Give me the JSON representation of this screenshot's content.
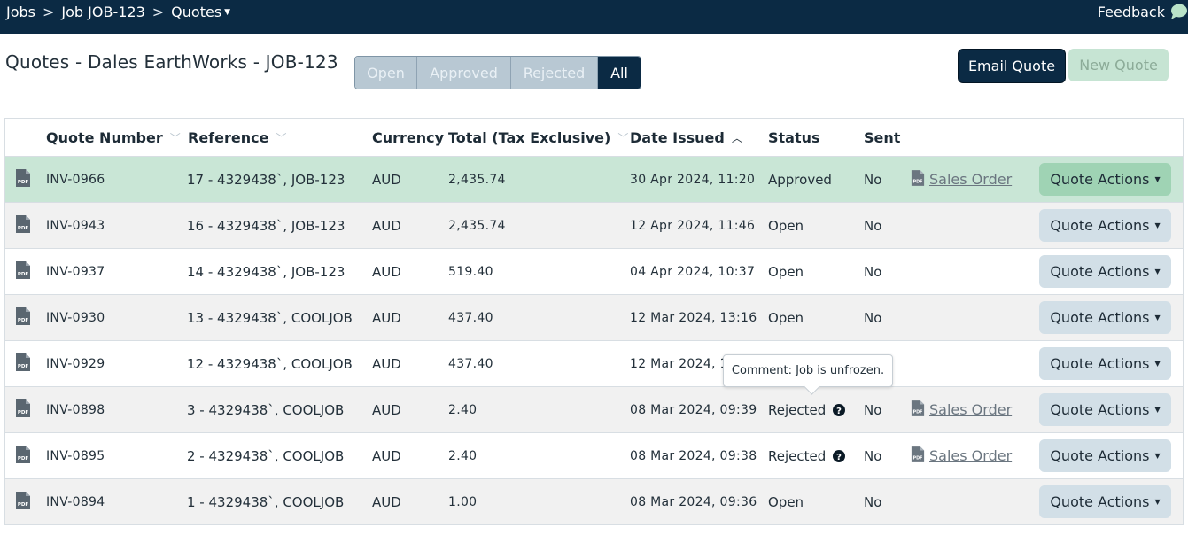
{
  "breadcrumb": {
    "items": [
      "Jobs",
      "Job JOB-123",
      "Quotes"
    ],
    "separator": ">"
  },
  "feedback_label": "Feedback",
  "page_title": "Quotes - Dales EarthWorks - JOB-123",
  "filters": [
    {
      "label": "Open",
      "active": false
    },
    {
      "label": "Approved",
      "active": false
    },
    {
      "label": "Rejected",
      "active": false
    },
    {
      "label": "All",
      "active": true
    }
  ],
  "buttons": {
    "email_quote": "Email Quote",
    "new_quote": "New Quote"
  },
  "table": {
    "headers": {
      "quote_number": "Quote Number",
      "reference": "Reference",
      "currency": "Currency",
      "total": "Total (Tax Exclusive)",
      "date_issued": "Date Issued",
      "status": "Status",
      "sent": "Sent"
    },
    "rows": [
      {
        "quote_number": "INV-0966",
        "reference": "17 - 4329438`, JOB-123",
        "currency": "AUD",
        "total": "2,435.74",
        "date_issued": "30 Apr 2024, 11:20",
        "status": "Approved",
        "sent": "No",
        "sales_order": "Sales Order",
        "action": "Quote Actions"
      },
      {
        "quote_number": "INV-0943",
        "reference": "16 - 4329438`, JOB-123",
        "currency": "AUD",
        "total": "2,435.74",
        "date_issued": "12 Apr 2024, 11:46",
        "status": "Open",
        "sent": "No",
        "sales_order": "",
        "action": "Quote Actions"
      },
      {
        "quote_number": "INV-0937",
        "reference": "14 - 4329438`, JOB-123",
        "currency": "AUD",
        "total": "519.40",
        "date_issued": "04 Apr 2024, 10:37",
        "status": "Open",
        "sent": "No",
        "sales_order": "",
        "action": "Quote Actions"
      },
      {
        "quote_number": "INV-0930",
        "reference": "13 - 4329438`, COOLJOB",
        "currency": "AUD",
        "total": "437.40",
        "date_issued": "12 Mar 2024, 13:16",
        "status": "Open",
        "sent": "No",
        "sales_order": "",
        "action": "Quote Actions"
      },
      {
        "quote_number": "INV-0929",
        "reference": "12 - 4329438`, COOLJOB",
        "currency": "AUD",
        "total": "437.40",
        "date_issued": "12 Mar 2024, 1",
        "status": "",
        "sent": "",
        "sales_order": "",
        "action": "Quote Actions"
      },
      {
        "quote_number": "INV-0898",
        "reference": "3 - 4329438`, COOLJOB",
        "currency": "AUD",
        "total": "2.40",
        "date_issued": "08 Mar 2024, 09:39",
        "status": "Rejected",
        "sent": "No",
        "sales_order": "Sales Order",
        "action": "Quote Actions"
      },
      {
        "quote_number": "INV-0895",
        "reference": "2 - 4329438`, COOLJOB",
        "currency": "AUD",
        "total": "2.40",
        "date_issued": "08 Mar 2024, 09:38",
        "status": "Rejected",
        "sent": "No",
        "sales_order": "Sales Order",
        "action": "Quote Actions"
      },
      {
        "quote_number": "INV-0894",
        "reference": "1 - 4329438`, COOLJOB",
        "currency": "AUD",
        "total": "1.00",
        "date_issued": "08 Mar 2024, 09:36",
        "status": "Open",
        "sent": "No",
        "sales_order": "",
        "action": "Quote Actions"
      }
    ]
  },
  "tooltip": "Comment: Job is unfrozen.",
  "colors": {
    "navbar": "#0b2a44",
    "approved_row": "#c9e6d6",
    "approved_action": "#9fd3b4",
    "action_button": "#d2dfe7",
    "new_quote_disabled": "#c6e4d3"
  },
  "icons": {
    "file": "pdf-file-icon",
    "help": "question-circle-icon",
    "feedback": "speech-bubble-icon",
    "sort": "chevron-down-icon",
    "sort_active": "chevron-up-icon"
  }
}
